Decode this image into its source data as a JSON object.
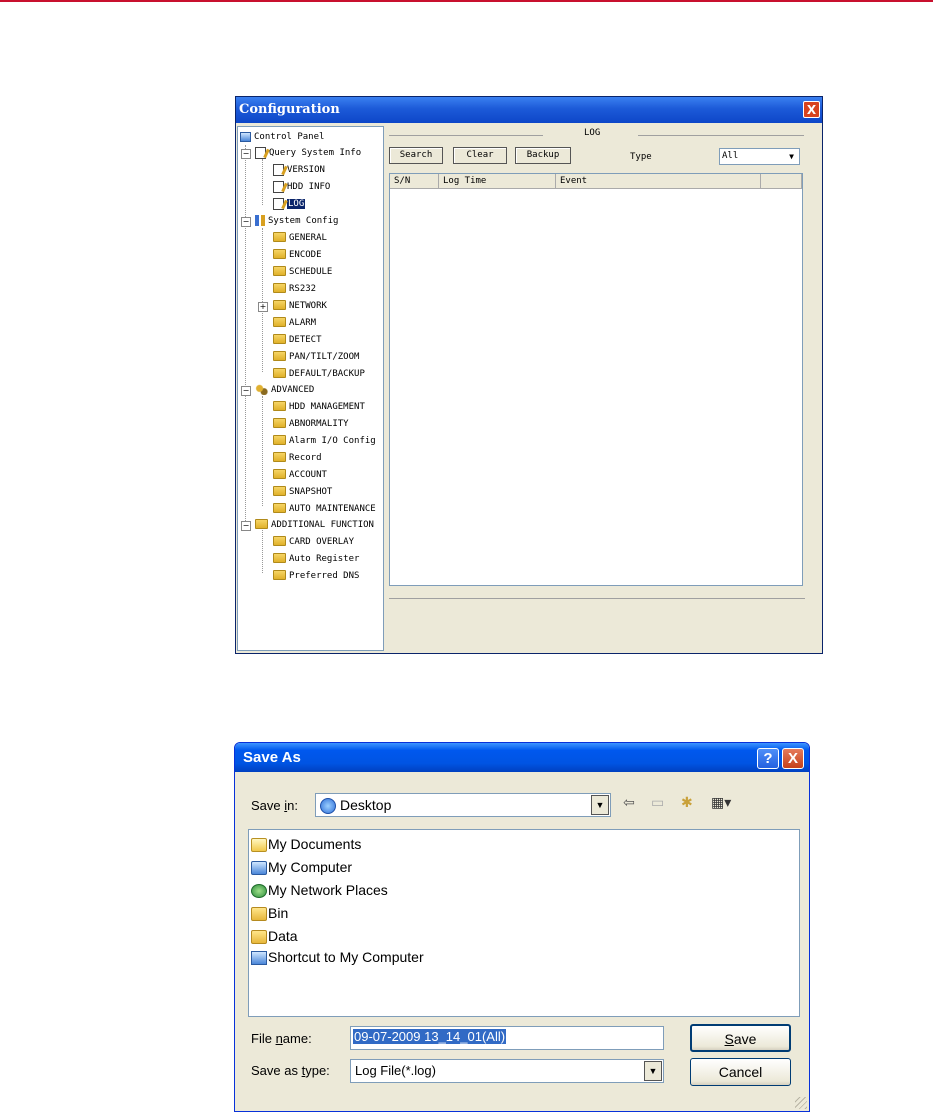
{
  "config_window": {
    "title": "Configuration",
    "close_glyph": "X",
    "tree": [
      {
        "label": "Control Panel",
        "icon": "computer-icon"
      },
      {
        "label": "Query System Info",
        "icon": "note-icon"
      },
      {
        "label": "VERSION",
        "icon": "note-icon"
      },
      {
        "label": "HDD INFO",
        "icon": "note-icon"
      },
      {
        "label": "LOG",
        "icon": "note-icon"
      },
      {
        "label": "System Config",
        "icon": "tools-icon"
      },
      {
        "label": "GENERAL",
        "icon": "folder-icon"
      },
      {
        "label": "ENCODE",
        "icon": "folder-icon"
      },
      {
        "label": "SCHEDULE",
        "icon": "folder-icon"
      },
      {
        "label": "RS232",
        "icon": "folder-icon"
      },
      {
        "label": "NETWORK",
        "icon": "folder-icon"
      },
      {
        "label": "ALARM",
        "icon": "folder-icon"
      },
      {
        "label": "DETECT",
        "icon": "folder-icon"
      },
      {
        "label": "PAN/TILT/ZOOM",
        "icon": "folder-icon"
      },
      {
        "label": "DEFAULT/BACKUP",
        "icon": "folder-icon"
      },
      {
        "label": "ADVANCED",
        "icon": "gears-icon"
      },
      {
        "label": "HDD MANAGEMENT",
        "icon": "folder-icon"
      },
      {
        "label": "ABNORMALITY",
        "icon": "folder-icon"
      },
      {
        "label": "Alarm I/O Config",
        "icon": "folder-icon"
      },
      {
        "label": "Record",
        "icon": "folder-icon"
      },
      {
        "label": "ACCOUNT",
        "icon": "folder-icon"
      },
      {
        "label": "SNAPSHOT",
        "icon": "folder-icon"
      },
      {
        "label": "AUTO MAINTENANCE",
        "icon": "folder-icon"
      },
      {
        "label": "ADDITIONAL FUNCTION",
        "icon": "folder-icon"
      },
      {
        "label": "CARD OVERLAY",
        "icon": "folder-icon"
      },
      {
        "label": "Auto Register",
        "icon": "folder-icon"
      },
      {
        "label": "Preferred DNS",
        "icon": "folder-icon"
      }
    ],
    "selected_node": "LOG",
    "log_panel": {
      "group_title": "LOG",
      "search_label": "Search",
      "clear_label": "Clear",
      "backup_label": "Backup",
      "type_label": "Type",
      "type_value": "All",
      "columns": [
        "S/N",
        "Log Time",
        "Event"
      ]
    }
  },
  "save_as": {
    "title": "Save As",
    "help_glyph": "?",
    "close_glyph": "X",
    "save_in_label_pre": "Save ",
    "save_in_label_u": "i",
    "save_in_label_post": "n:",
    "save_in_value": "Desktop",
    "items": [
      {
        "label": "My Documents",
        "icon": "my-documents-icon"
      },
      {
        "label": "My Computer",
        "icon": "my-computer-icon"
      },
      {
        "label": "My Network Places",
        "icon": "network-places-icon"
      },
      {
        "label": "Bin",
        "icon": "folder-icon"
      },
      {
        "label": "Data",
        "icon": "folder-icon"
      },
      {
        "label": "Shortcut to My Computer",
        "icon": "shortcut-icon"
      }
    ],
    "file_name_label_pre": "File ",
    "file_name_label_u": "n",
    "file_name_label_post": "ame:",
    "file_name_value": "09-07-2009 13_14_01(All)",
    "type_label_pre": "Save as ",
    "type_label_u": "t",
    "type_label_post": "ype:",
    "type_value": "Log File(*.log)",
    "save_label_u": "S",
    "save_label_rest": "ave",
    "cancel_label": "Cancel"
  }
}
